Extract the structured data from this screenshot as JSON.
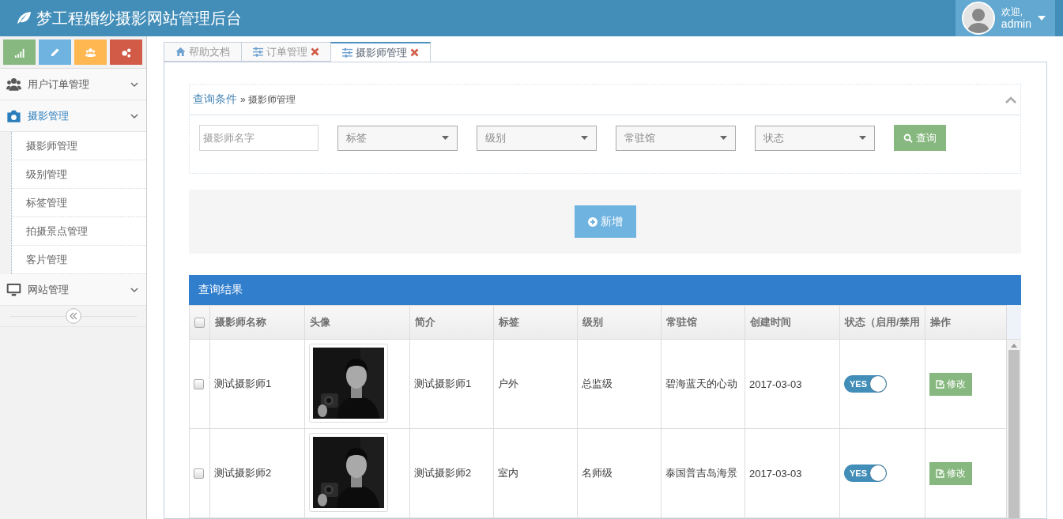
{
  "header": {
    "title": "梦工程婚纱摄影网站管理后台",
    "user": {
      "greeting": "欢迎,",
      "name": "admin"
    }
  },
  "shortcuts": [
    {
      "kind": "chart",
      "color": "#87b87f"
    },
    {
      "kind": "pencil",
      "color": "#6fb3e0"
    },
    {
      "kind": "users",
      "color": "#ffb752"
    },
    {
      "kind": "cogs",
      "color": "#d15b47"
    }
  ],
  "sidebar": {
    "items": [
      {
        "label": "用户订单管理",
        "kind": "users",
        "selected": false
      },
      {
        "label": "摄影管理",
        "kind": "camera",
        "selected": true,
        "children": [
          {
            "label": "摄影师管理"
          },
          {
            "label": "级别管理"
          },
          {
            "label": "标签管理"
          },
          {
            "label": "拍摄景点管理"
          },
          {
            "label": "客片管理"
          }
        ]
      },
      {
        "label": "网站管理",
        "kind": "monitor",
        "selected": false
      }
    ]
  },
  "tabs": [
    {
      "label": "帮助文档",
      "kind": "home",
      "closable": false,
      "selected": false
    },
    {
      "label": "订单管理",
      "kind": "sliders",
      "closable": true,
      "selected": false
    },
    {
      "label": "摄影师管理",
      "kind": "sliders",
      "closable": true,
      "selected": true
    }
  ],
  "query": {
    "title": "查询条件",
    "crumb_separator": "»",
    "crumb": "摄影师管理",
    "expanded": true,
    "fields": [
      {
        "kind": "input",
        "placeholder": "摄影师名字"
      },
      {
        "kind": "select",
        "value": "标签"
      },
      {
        "kind": "select",
        "value": "级别"
      },
      {
        "kind": "select",
        "value": "常驻馆"
      },
      {
        "kind": "select",
        "value": "状态"
      }
    ],
    "search_button": "查询"
  },
  "add_button": "新增",
  "results": {
    "title": "查询结果",
    "all_checked": false,
    "columns": [
      "摄影师名称",
      "头像",
      "简介",
      "标签",
      "级别",
      "常驻馆",
      "创建时间",
      "状态（启用/禁用",
      "操作"
    ],
    "rows": [
      {
        "checked": false,
        "name": "测试摄影师1",
        "intro": "测试摄影师1",
        "tag": "户外",
        "level": "总监级",
        "studio": "碧海蓝天的心动",
        "created": "2017-03-03",
        "status": {
          "label": "YES",
          "on": true
        },
        "action": "修改"
      },
      {
        "checked": false,
        "name": "测试摄影师2",
        "intro": "测试摄影师2",
        "tag": "室内",
        "level": "名师级",
        "studio": "泰国普吉岛海景",
        "created": "2017-03-03",
        "status": {
          "label": "YES",
          "on": true
        },
        "action": "修改"
      }
    ]
  }
}
